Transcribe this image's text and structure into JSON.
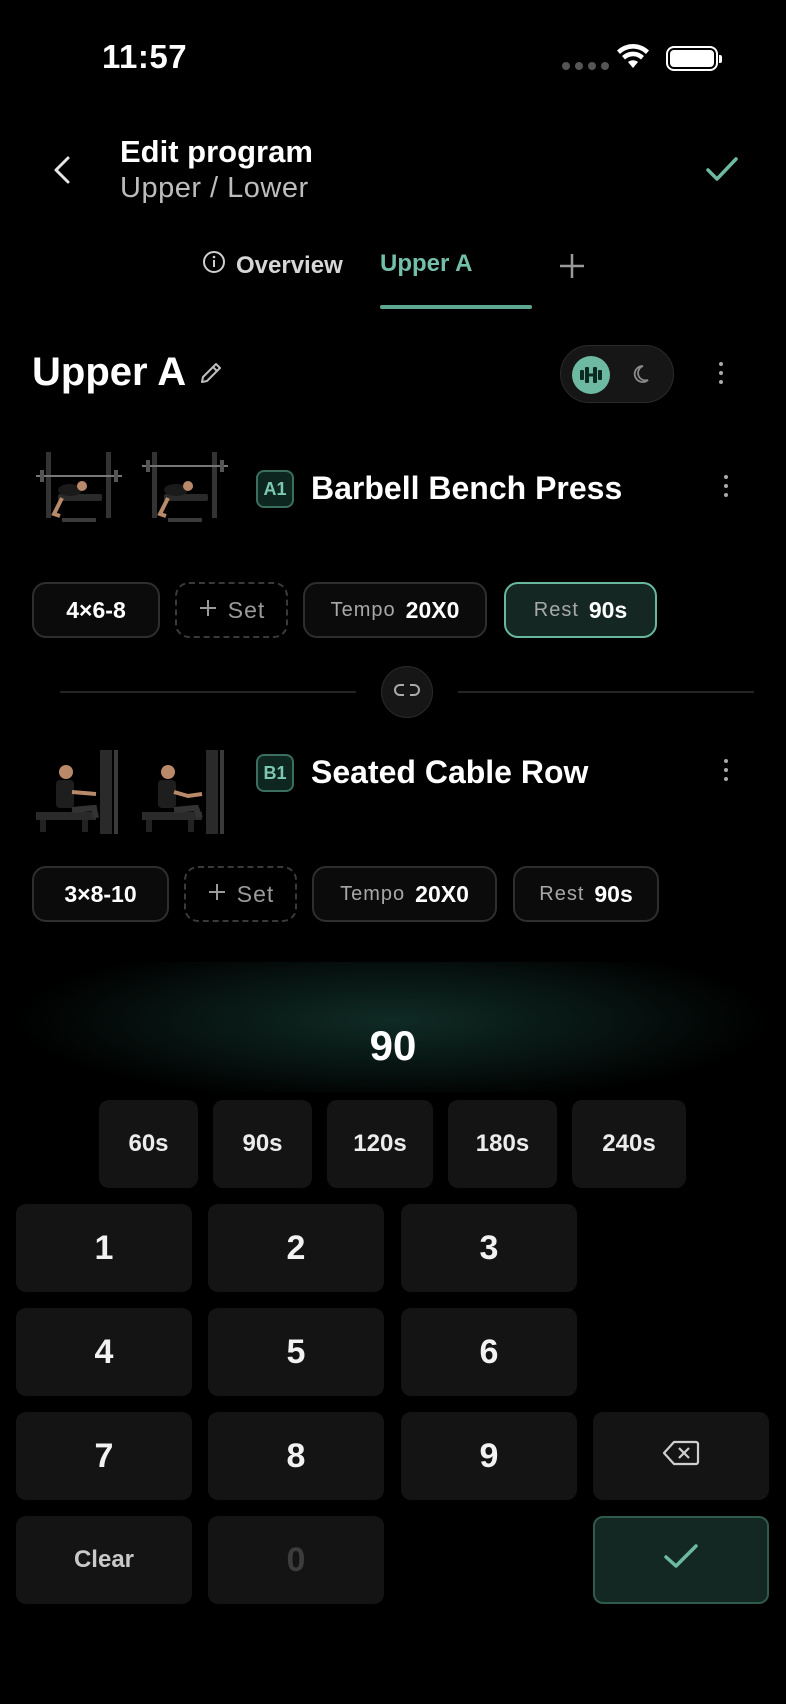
{
  "status_bar": {
    "time": "11:57"
  },
  "header": {
    "title": "Edit program",
    "subtitle": "Upper / Lower"
  },
  "tabs": [
    {
      "label": "Overview",
      "active": false
    },
    {
      "label": "Upper A",
      "active": true
    }
  ],
  "day": {
    "title": "Upper A",
    "mode_selected": "strength"
  },
  "exercises": [
    {
      "badge": "A1",
      "name": "Barbell Bench Press",
      "scheme": "4×6-8",
      "add_set_label": "Set",
      "tempo_label": "Tempo",
      "tempo_value": "20X0",
      "rest_label": "Rest",
      "rest_value": "90s",
      "rest_active": true
    },
    {
      "badge": "B1",
      "name": "Seated Cable Row",
      "scheme": "3×8-10",
      "add_set_label": "Set",
      "tempo_label": "Tempo",
      "tempo_value": "20X0",
      "rest_label": "Rest",
      "rest_value": "90s",
      "rest_active": false
    }
  ],
  "keypad": {
    "display_value": "90",
    "presets": [
      "60s",
      "90s",
      "120s",
      "180s",
      "240s"
    ],
    "keys": [
      "1",
      "2",
      "3",
      "4",
      "5",
      "6",
      "7",
      "8",
      "9"
    ],
    "clear_label": "Clear",
    "zero_label": "0"
  },
  "colors": {
    "accent": "#6eb9a2",
    "background": "#000000",
    "surface": "#141414"
  }
}
